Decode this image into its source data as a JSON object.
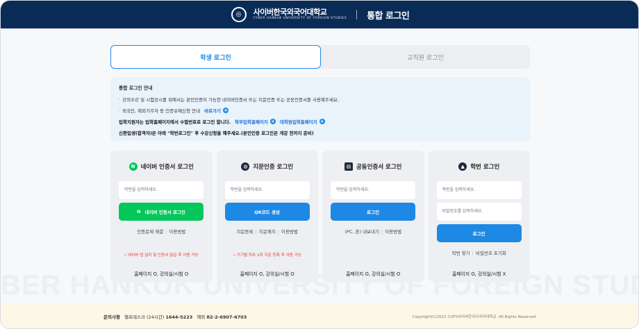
{
  "header": {
    "logo_ko": "사이버한국외국어대학교",
    "logo_en": "CYBER HANKUK UNIVERSITY OF FOREIGN STUDIES",
    "title": "통합 로그인"
  },
  "watermark": "BER HANKUK UNIVERSITY OF FOREIGN STUD",
  "tabs": [
    {
      "label": "학생 로그인",
      "active": true
    },
    {
      "label": "교직원 로그인",
      "active": false
    }
  ],
  "notice": {
    "title": "통합 로그인 안내",
    "line1": "강의수강 및 시험응시를 위해서는 본인인증이 가능한 네이버인증서 또는 지문인증 또는 공동인증서를 사용해주세요.",
    "line2": "외국인, 해외거주자 등 인증유예신청 안내",
    "line2_link": "바로가기",
    "line3": "입학지원자는 입학홈페이지에서 수험번호로 로그인 합니다.",
    "line3_link1": "학부입학홈페이지",
    "line3_link2": "대학원입학홈페이지",
    "line4": "신편입생(합격자)은 아래 \"학번로그인\" 후 수강신청을 해주세요.(본인인증 로그인은 개강 전까지 준비)"
  },
  "cards": [
    {
      "title": "네이버 인증서 로그인",
      "icon": "naver-icon",
      "input_placeholder": "학번을 입력하세요.",
      "button": "네이버 인증서 로그인",
      "links": [
        "인증문제 해결",
        "이용방법"
      ],
      "warning": "• 네이버 앱 설치 및 인증서 발급 후 사용 가능",
      "availability": "홈페이지 O, 강의실/시험 O"
    },
    {
      "title": "지문인증 로그인",
      "icon": "fingerprint-icon",
      "input_placeholder": "학번을 입력하세요.",
      "button": "QR코드 생성",
      "links": [
        "지문등록",
        "지문해지",
        "이용방법"
      ],
      "warning": "• 기기별 최초 1회 지문 등록 후 사용 가능",
      "availability": "홈페이지 O, 강의실/시험 O"
    },
    {
      "title": "공동인증서 로그인",
      "icon": "certificate-icon",
      "input_placeholder": "학번을 입력하세요.",
      "button": "로그인",
      "links": [
        "(PC, 폰) 내보내기",
        "이용방법"
      ],
      "availability": "홈페이지 O, 강의실/시험 O"
    },
    {
      "title": "학번 로그인",
      "icon": "graduation-cap-icon",
      "input_placeholder": "학번을 입력하세요.",
      "password_placeholder": "비밀번호를 입력하세요.",
      "button": "로그인",
      "links": [
        "학번 찾기",
        "비밀번호 초기화"
      ],
      "availability": "홈페이지 O, 강의실/시험 X"
    }
  ],
  "footer": {
    "label": "문의사항",
    "helpdesk_label": "헬프데스크 (24시간)",
    "helpdesk_number": "1644-5223",
    "overseas_label": "해외",
    "overseas_number": "82-2-6907-6703",
    "copyright": "Copyright(C)2021 CUFS사이버한국외국어대학교. All Rights Reserved."
  },
  "colors": {
    "header_bg": "#0b2b57",
    "accent_blue": "#1e88e5",
    "naver_green": "#03c75a",
    "warning_red": "#e53935"
  }
}
